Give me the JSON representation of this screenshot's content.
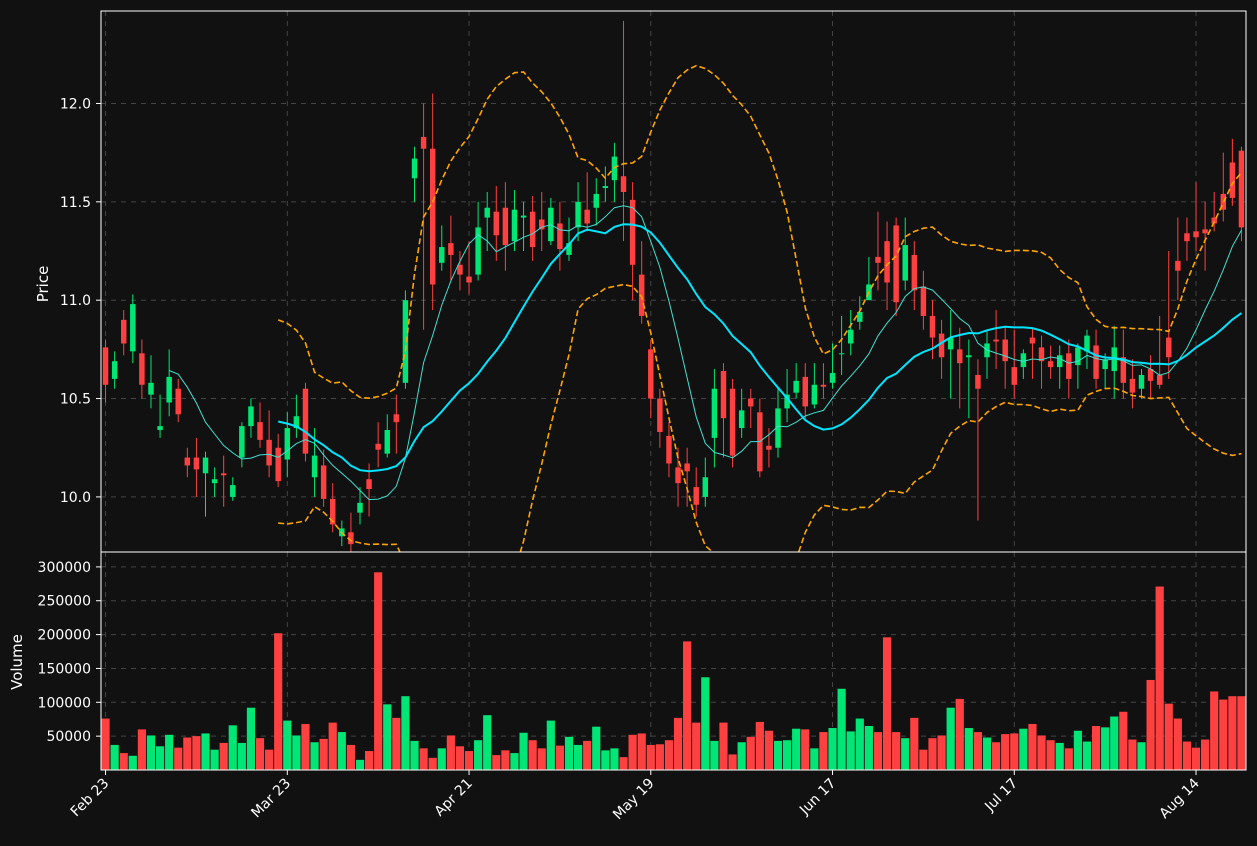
{
  "chart_data": {
    "type": "candlestick",
    "grid": true,
    "background": "#111111",
    "colors": {
      "up": "#00e676",
      "down": "#ff4040",
      "sma_long": "#00e5ff",
      "sma_short": "#40e0d0",
      "bollinger": "#ffa500",
      "grid": "#444444",
      "axis": "#ffffff"
    },
    "price_panel": {
      "ylabel": "Price",
      "ylim": [
        9.72,
        12.47
      ],
      "yticks": [
        10.0,
        10.5,
        11.0,
        11.5,
        12.0
      ],
      "ytick_labels": [
        "10.0",
        "10.5",
        "11.0",
        "11.5",
        "12.0"
      ]
    },
    "volume_panel": {
      "ylabel": "Volume",
      "ylim": [
        0,
        322000
      ],
      "yticks": [
        50000,
        100000,
        150000,
        200000,
        250000,
        300000
      ],
      "ytick_labels": [
        "50000",
        "100000",
        "150000",
        "200000",
        "250000",
        "300000"
      ]
    },
    "xlim": [
      -0.5,
      125.5
    ],
    "xticks": [
      0,
      20,
      40,
      60,
      80,
      100,
      120
    ],
    "xtick_labels": [
      "Feb 23",
      "Mar 23",
      "Apr 21",
      "May 19",
      "Jun 17",
      "Jul 17",
      "Aug 14"
    ],
    "sma_short_window": 8,
    "sma_long_window": 20,
    "close": [
      10.57,
      10.69,
      10.78,
      10.98,
      10.57,
      10.58,
      10.36,
      10.61,
      10.42,
      10.16,
      10.14,
      10.2,
      10.09,
      10.11,
      10.06,
      10.36,
      10.46,
      10.29,
      10.16,
      10.08,
      10.35,
      10.41,
      10.22,
      10.21,
      9.99,
      9.86,
      9.84,
      9.76,
      9.97,
      10.04,
      10.24,
      10.34,
      10.38,
      11.0,
      11.72,
      11.77,
      11.08,
      11.27,
      11.23,
      11.13,
      11.09,
      11.37,
      11.47,
      11.33,
      11.28,
      11.46,
      11.43,
      11.27,
      11.36,
      11.47,
      11.26,
      11.29,
      11.5,
      11.39,
      11.54,
      11.58,
      11.73,
      11.55,
      11.18,
      10.92,
      10.5,
      10.33,
      10.17,
      10.07,
      10.13,
      9.96,
      10.1,
      10.55,
      10.4,
      10.21,
      10.44,
      10.46,
      10.13,
      10.24,
      10.45,
      10.52,
      10.59,
      10.46,
      10.57,
      10.56,
      10.63,
      10.73,
      10.85,
      10.94,
      11.08,
      11.19,
      11.09,
      10.99,
      11.28,
      11.05,
      10.92,
      10.81,
      10.71,
      10.81,
      10.68,
      10.72,
      10.55,
      10.78,
      10.79,
      10.69,
      10.57,
      10.73,
      10.78,
      10.69,
      10.66,
      10.72,
      10.6,
      10.76,
      10.82,
      10.6,
      10.7,
      10.76,
      10.58,
      10.53,
      10.62,
      10.59,
      10.57,
      10.71,
      11.15,
      11.3,
      11.32,
      11.34,
      11.39,
      11.46,
      11.52,
      11.37
    ],
    "open": [
      10.76,
      10.6,
      10.9,
      10.74,
      10.73,
      10.52,
      10.34,
      10.48,
      10.55,
      10.2,
      10.2,
      10.12,
      10.07,
      10.12,
      10.0,
      10.2,
      10.36,
      10.38,
      10.29,
      10.25,
      10.19,
      10.35,
      10.55,
      10.1,
      10.16,
      9.99,
      9.8,
      9.82,
      9.92,
      10.09,
      10.27,
      10.22,
      10.42,
      10.58,
      11.62,
      11.83,
      11.77,
      11.19,
      11.29,
      11.18,
      11.12,
      11.13,
      11.42,
      11.45,
      11.47,
      11.3,
      11.42,
      11.45,
      11.41,
      11.3,
      11.39,
      11.23,
      11.37,
      11.46,
      11.47,
      11.57,
      11.61,
      11.63,
      11.51,
      11.13,
      10.75,
      10.5,
      10.31,
      10.15,
      10.17,
      10.05,
      10.0,
      10.3,
      10.64,
      10.55,
      10.35,
      10.5,
      10.43,
      10.26,
      10.25,
      10.45,
      10.53,
      10.61,
      10.47,
      10.57,
      10.58,
      10.73,
      10.78,
      10.89,
      11.0,
      11.22,
      11.3,
      11.38,
      11.1,
      11.23,
      11.07,
      10.92,
      10.83,
      10.75,
      10.75,
      10.71,
      10.62,
      10.71,
      10.8,
      10.8,
      10.66,
      10.66,
      10.81,
      10.76,
      10.69,
      10.66,
      10.73,
      10.67,
      10.74,
      10.77,
      10.65,
      10.64,
      10.71,
      10.6,
      10.55,
      10.65,
      10.62,
      10.81,
      11.2,
      11.34,
      11.35,
      11.36,
      11.42,
      11.54,
      11.7,
      11.76
    ],
    "high": [
      10.8,
      10.74,
      10.95,
      11.03,
      10.8,
      10.72,
      10.52,
      10.75,
      10.6,
      10.25,
      10.3,
      10.23,
      10.15,
      10.21,
      10.1,
      10.38,
      10.5,
      10.48,
      10.44,
      10.32,
      10.43,
      10.52,
      10.58,
      10.35,
      10.24,
      10.07,
      9.88,
      9.92,
      10.05,
      10.17,
      10.38,
      10.42,
      10.52,
      11.05,
      11.78,
      12.0,
      12.05,
      11.38,
      11.43,
      11.25,
      11.3,
      11.5,
      11.55,
      11.58,
      11.6,
      11.56,
      11.5,
      11.53,
      11.55,
      11.52,
      11.5,
      11.42,
      11.6,
      11.65,
      11.62,
      11.68,
      11.8,
      12.42,
      11.6,
      11.3,
      10.8,
      10.55,
      10.38,
      10.25,
      10.25,
      10.15,
      10.2,
      10.65,
      10.68,
      10.6,
      10.55,
      10.55,
      10.5,
      10.35,
      10.55,
      10.65,
      10.68,
      10.68,
      10.68,
      10.68,
      10.78,
      10.92,
      10.95,
      11.02,
      11.22,
      11.45,
      11.4,
      11.42,
      11.42,
      11.3,
      11.15,
      11.0,
      10.9,
      10.95,
      10.86,
      10.8,
      10.7,
      10.85,
      10.95,
      10.87,
      10.85,
      10.75,
      10.86,
      10.82,
      10.77,
      10.77,
      10.8,
      10.78,
      10.85,
      10.85,
      10.73,
      10.87,
      10.85,
      10.7,
      10.65,
      10.72,
      10.92,
      11.25,
      11.42,
      11.42,
      11.6,
      11.5,
      11.55,
      11.75,
      11.82,
      11.78
    ],
    "low": [
      10.48,
      10.55,
      10.72,
      10.68,
      10.5,
      10.45,
      10.3,
      10.41,
      10.38,
      10.1,
      10.0,
      9.9,
      10.0,
      9.95,
      9.98,
      10.15,
      10.3,
      10.25,
      10.1,
      10.05,
      10.1,
      10.3,
      10.18,
      10.0,
      9.95,
      9.82,
      9.75,
      9.72,
      9.86,
      9.9,
      10.15,
      10.2,
      10.22,
      10.55,
      11.5,
      10.85,
      10.95,
      11.15,
      11.1,
      11.05,
      11.03,
      11.1,
      11.25,
      11.2,
      11.15,
      11.25,
      11.25,
      11.2,
      11.25,
      11.28,
      11.15,
      11.2,
      11.3,
      11.35,
      11.38,
      11.5,
      11.5,
      11.3,
      11.0,
      10.88,
      10.4,
      10.25,
      10.1,
      9.95,
      9.95,
      9.9,
      9.95,
      10.15,
      10.2,
      10.15,
      10.3,
      10.35,
      10.1,
      10.15,
      10.2,
      10.38,
      10.5,
      10.4,
      10.45,
      10.5,
      10.55,
      10.62,
      10.72,
      10.85,
      11.03,
      11.05,
      10.95,
      10.92,
      11.05,
      10.95,
      10.85,
      10.7,
      10.6,
      10.5,
      10.45,
      10.4,
      9.88,
      10.6,
      10.65,
      10.55,
      10.5,
      10.6,
      10.6,
      10.55,
      10.6,
      10.55,
      10.5,
      10.55,
      10.65,
      10.55,
      10.55,
      10.5,
      10.5,
      10.45,
      10.5,
      10.5,
      10.55,
      10.6,
      11.0,
      11.2,
      11.25,
      11.15,
      11.35,
      11.4,
      11.48,
      11.3
    ],
    "volume": [
      76000,
      37000,
      25000,
      21000,
      60000,
      51000,
      35000,
      52000,
      33000,
      48000,
      50000,
      54000,
      30000,
      40000,
      66000,
      40000,
      92000,
      47000,
      30000,
      202000,
      73000,
      51000,
      68000,
      41000,
      46000,
      70000,
      56000,
      37000,
      15000,
      28000,
      292000,
      97000,
      77000,
      109000,
      43000,
      32000,
      18000,
      32000,
      51000,
      35000,
      28000,
      44000,
      81000,
      22000,
      29000,
      25000,
      55000,
      44000,
      32000,
      73000,
      36000,
      49000,
      37000,
      43000,
      64000,
      29000,
      32000,
      19000,
      52000,
      54000,
      37000,
      38000,
      44000,
      77000,
      190000,
      70000,
      137000,
      43000,
      70000,
      23000,
      41000,
      49000,
      71000,
      58000,
      43000,
      44000,
      61000,
      60000,
      32000,
      56000,
      62000,
      120000,
      57000,
      76000,
      65000,
      56000,
      196000,
      56000,
      47000,
      77000,
      30000,
      47000,
      51000,
      92000,
      105000,
      62000,
      56000,
      48000,
      41000,
      53000,
      54000,
      61000,
      68000,
      51000,
      44000,
      40000,
      32000,
      58000,
      42000,
      65000,
      63000,
      79000,
      86000,
      45000,
      41000,
      133000,
      271000,
      98000,
      76000,
      42000,
      33000,
      45000,
      116000,
      104000,
      109000,
      109000
    ]
  }
}
